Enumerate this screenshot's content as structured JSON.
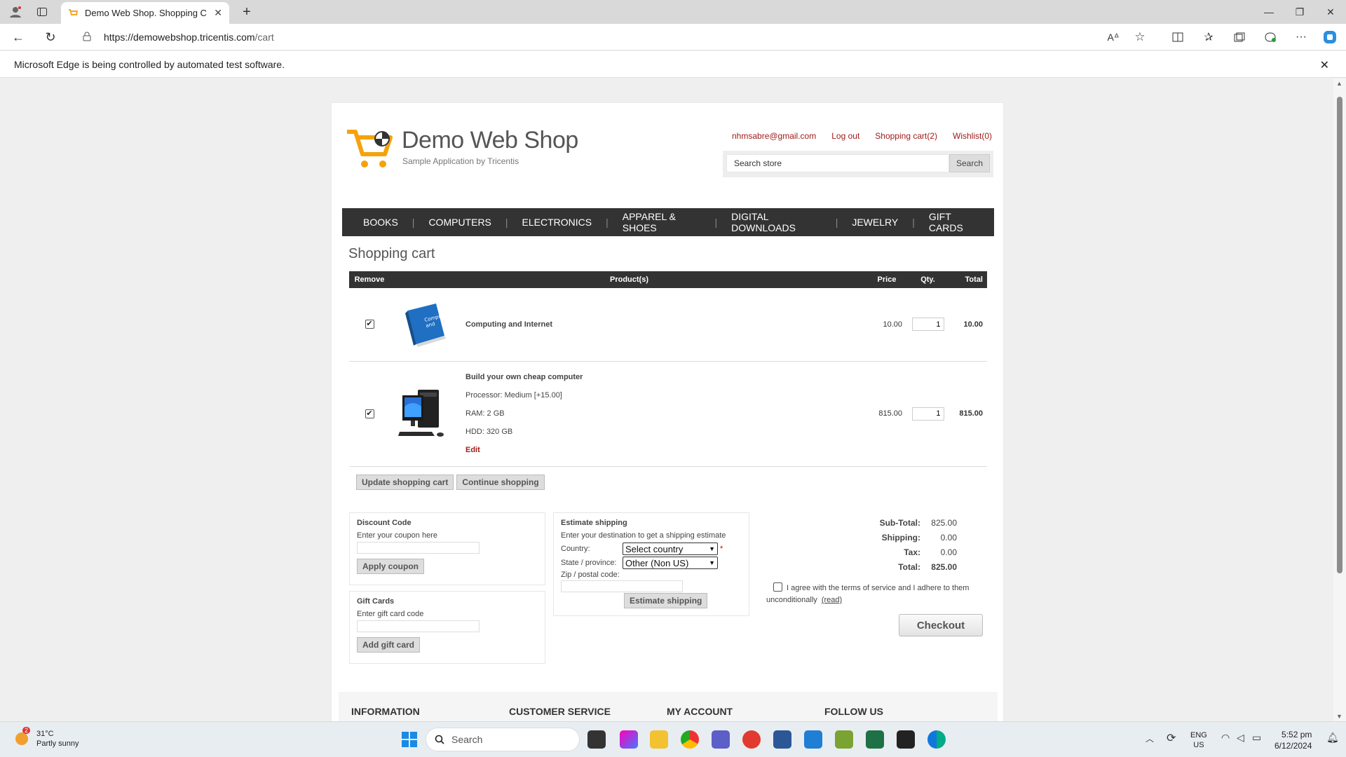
{
  "browser": {
    "tab_title": "Demo Web Shop. Shopping Cart",
    "url_host": "https://demowebshop.tricentis.com",
    "url_path": "/cart",
    "automation_notice": "Microsoft Edge is being controlled by automated test software."
  },
  "header": {
    "store_name": "Demo Web Shop",
    "store_subtitle": "Sample Application by Tricentis",
    "links": [
      "nhmsabre@gmail.com",
      "Log out",
      "Shopping cart(2)",
      "Wishlist(0)"
    ],
    "search_placeholder": "Search store",
    "search_button": "Search"
  },
  "menu": [
    "BOOKS",
    "COMPUTERS",
    "ELECTRONICS",
    "APPAREL & SHOES",
    "DIGITAL DOWNLOADS",
    "JEWELRY",
    "GIFT CARDS"
  ],
  "cart": {
    "title": "Shopping cart",
    "columns": [
      "Remove",
      "Product(s)",
      "Price",
      "Qty.",
      "Total"
    ],
    "items": [
      {
        "name": "Computing and Internet",
        "price": "10.00",
        "qty": "1",
        "total": "10.00",
        "checked": true,
        "attributes": []
      },
      {
        "name": "Build your own cheap computer",
        "price": "815.00",
        "qty": "1",
        "total": "815.00",
        "checked": true,
        "attributes": [
          "Processor: Medium [+15.00]",
          "RAM: 2 GB",
          "HDD: 320 GB"
        ],
        "edit_label": "Edit"
      }
    ],
    "update_button": "Update shopping cart",
    "continue_button": "Continue shopping"
  },
  "discount": {
    "title": "Discount Code",
    "hint": "Enter your coupon here",
    "button": "Apply coupon"
  },
  "giftcard": {
    "title": "Gift Cards",
    "hint": "Enter gift card code",
    "button": "Add gift card"
  },
  "shipping": {
    "title": "Estimate shipping",
    "hint": "Enter your destination to get a shipping estimate",
    "country_label": "Country:",
    "country_value": "Select country",
    "required_mark": "*",
    "state_label": "State / province:",
    "state_value": "Other (Non US)",
    "zip_label": "Zip / postal code:",
    "button": "Estimate shipping"
  },
  "totals": {
    "subtotal_label": "Sub-Total:",
    "subtotal": "825.00",
    "shipping_label": "Shipping:",
    "shipping": "0.00",
    "tax_label": "Tax:",
    "tax": "0.00",
    "total_label": "Total:",
    "total": "825.00"
  },
  "terms": {
    "text": "I agree with the terms of service and I adhere to them unconditionally",
    "read_link": "(read)"
  },
  "checkout_button": "Checkout",
  "footer": [
    "INFORMATION",
    "CUSTOMER SERVICE",
    "MY ACCOUNT",
    "FOLLOW US"
  ],
  "taskbar": {
    "weather_temp": "31°C",
    "weather_desc": "Partly sunny",
    "weather_badge": "2",
    "search_label": "Search",
    "lang": "ENG",
    "region": "US",
    "time": "5:52 pm",
    "date": "6/12/2024"
  },
  "colors": {
    "accent_link": "#a01b1b",
    "menu_bg": "#333333",
    "total_green": "#2f8a2f"
  }
}
